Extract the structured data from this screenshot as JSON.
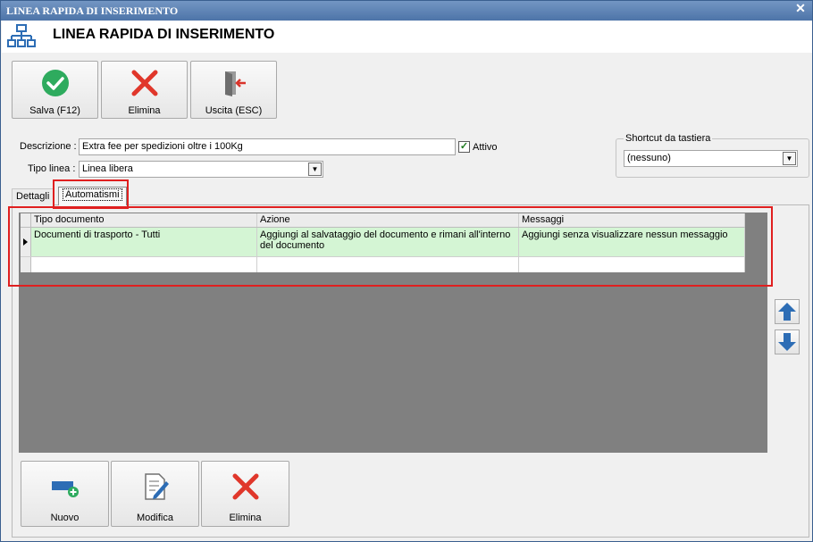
{
  "window": {
    "title": "LINEA RAPIDA DI INSERIMENTO",
    "close_glyph": "✕"
  },
  "header": {
    "title": "LINEA RAPIDA DI INSERIMENTO",
    "icon": "hierarchy-icon"
  },
  "toolbar": {
    "save_label": "Salva (F12)",
    "delete_label": "Elimina",
    "exit_label": "Uscita (ESC)"
  },
  "form": {
    "description_label": "Descrizione :",
    "description_value": "Extra fee per spedizioni oltre i 100Kg",
    "active_label": "Attivo",
    "active_checked": true,
    "line_type_label": "Tipo linea :",
    "line_type_value": "Linea libera",
    "shortcut_group_label": "Shortcut da tastiera",
    "shortcut_value": "(nessuno)"
  },
  "tabs": [
    {
      "label": "Dettagli",
      "active": false
    },
    {
      "label": "Automatismi",
      "active": true
    }
  ],
  "grid": {
    "columns": [
      "Tipo documento",
      "Azione",
      "Messaggi"
    ],
    "rows": [
      {
        "tipo_documento": "Documenti di trasporto - Tutti",
        "azione": "Aggiungi al salvataggio del documento e rimani all'interno del documento",
        "messaggi": "Aggiungi senza visualizzare nessun messaggio"
      }
    ]
  },
  "bottom_toolbar": {
    "new_label": "Nuovo",
    "edit_label": "Modifica",
    "delete_label": "Elimina"
  },
  "colors": {
    "highlight": "#e01f1f",
    "selected_row": "#d4f5d4",
    "accent_green": "#2eab5e",
    "accent_red": "#e0372b",
    "accent_blue": "#2d6db5"
  }
}
